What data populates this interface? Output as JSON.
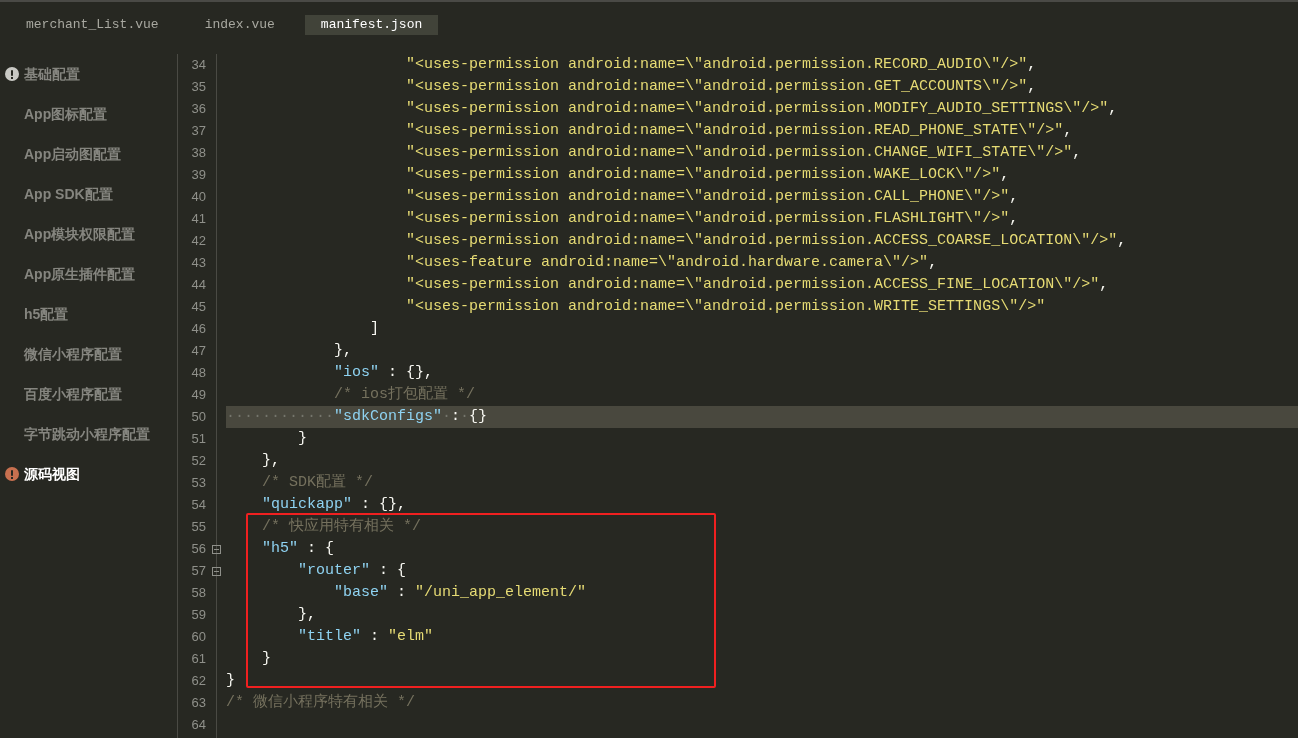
{
  "tabs": [
    {
      "label": "merchant_List.vue",
      "selected": false
    },
    {
      "label": "index.vue",
      "selected": false
    },
    {
      "label": "manifest.json",
      "selected": true
    }
  ],
  "sidebar": {
    "items": [
      {
        "label": "基础配置",
        "warning": true,
        "selected": false
      },
      {
        "label": "App图标配置",
        "warning": false,
        "selected": false
      },
      {
        "label": "App启动图配置",
        "warning": false,
        "selected": false
      },
      {
        "label": "App SDK配置",
        "warning": false,
        "selected": false
      },
      {
        "label": "App模块权限配置",
        "warning": false,
        "selected": false
      },
      {
        "label": "App原生插件配置",
        "warning": false,
        "selected": false
      },
      {
        "label": "h5配置",
        "warning": false,
        "selected": false
      },
      {
        "label": "微信小程序配置",
        "warning": false,
        "selected": false
      },
      {
        "label": "百度小程序配置",
        "warning": false,
        "selected": false
      },
      {
        "label": "字节跳动小程序配置",
        "warning": false,
        "selected": false
      },
      {
        "label": "源码视图",
        "warning": true,
        "selected": true
      }
    ]
  },
  "editor": {
    "lines": [
      {
        "number": "34",
        "foldable": false,
        "highlighted": false,
        "boxed": false,
        "tokens": [
          {
            "kind": "string",
            "text": "                    \"<uses-permission android:name=\\\"android.permission.RECORD_AUDIO\\\"/>\""
          },
          {
            "kind": "punct",
            "text": ","
          }
        ]
      },
      {
        "number": "35",
        "foldable": false,
        "highlighted": false,
        "boxed": false,
        "tokens": [
          {
            "kind": "string",
            "text": "                    \"<uses-permission android:name=\\\"android.permission.GET_ACCOUNTS\\\"/>\""
          },
          {
            "kind": "punct",
            "text": ","
          }
        ]
      },
      {
        "number": "36",
        "foldable": false,
        "highlighted": false,
        "boxed": false,
        "tokens": [
          {
            "kind": "string",
            "text": "                    \"<uses-permission android:name=\\\"android.permission.MODIFY_AUDIO_SETTINGS\\\"/>\""
          },
          {
            "kind": "punct",
            "text": ","
          }
        ]
      },
      {
        "number": "37",
        "foldable": false,
        "highlighted": false,
        "boxed": false,
        "tokens": [
          {
            "kind": "string",
            "text": "                    \"<uses-permission android:name=\\\"android.permission.READ_PHONE_STATE\\\"/>\""
          },
          {
            "kind": "punct",
            "text": ","
          }
        ]
      },
      {
        "number": "38",
        "foldable": false,
        "highlighted": false,
        "boxed": false,
        "tokens": [
          {
            "kind": "string",
            "text": "                    \"<uses-permission android:name=\\\"android.permission.CHANGE_WIFI_STATE\\\"/>\""
          },
          {
            "kind": "punct",
            "text": ","
          }
        ]
      },
      {
        "number": "39",
        "foldable": false,
        "highlighted": false,
        "boxed": false,
        "tokens": [
          {
            "kind": "string",
            "text": "                    \"<uses-permission android:name=\\\"android.permission.WAKE_LOCK\\\"/>\""
          },
          {
            "kind": "punct",
            "text": ","
          }
        ]
      },
      {
        "number": "40",
        "foldable": false,
        "highlighted": false,
        "boxed": false,
        "tokens": [
          {
            "kind": "string",
            "text": "                    \"<uses-permission android:name=\\\"android.permission.CALL_PHONE\\\"/>\""
          },
          {
            "kind": "punct",
            "text": ","
          }
        ]
      },
      {
        "number": "41",
        "foldable": false,
        "highlighted": false,
        "boxed": false,
        "tokens": [
          {
            "kind": "string",
            "text": "                    \"<uses-permission android:name=\\\"android.permission.FLASHLIGHT\\\"/>\""
          },
          {
            "kind": "punct",
            "text": ","
          }
        ]
      },
      {
        "number": "42",
        "foldable": false,
        "highlighted": false,
        "boxed": false,
        "tokens": [
          {
            "kind": "string",
            "text": "                    \"<uses-permission android:name=\\\"android.permission.ACCESS_COARSE_LOCATION\\\"/>\""
          },
          {
            "kind": "punct",
            "text": ","
          }
        ]
      },
      {
        "number": "43",
        "foldable": false,
        "highlighted": false,
        "boxed": false,
        "tokens": [
          {
            "kind": "string",
            "text": "                    \"<uses-feature android:name=\\\"android.hardware.camera\\\"/>\""
          },
          {
            "kind": "punct",
            "text": ","
          }
        ]
      },
      {
        "number": "44",
        "foldable": false,
        "highlighted": false,
        "boxed": false,
        "tokens": [
          {
            "kind": "string",
            "text": "                    \"<uses-permission android:name=\\\"android.permission.ACCESS_FINE_LOCATION\\\"/>\""
          },
          {
            "kind": "punct",
            "text": ","
          }
        ]
      },
      {
        "number": "45",
        "foldable": false,
        "highlighted": false,
        "boxed": false,
        "tokens": [
          {
            "kind": "string",
            "text": "                    \"<uses-permission android:name=\\\"android.permission.WRITE_SETTINGS\\\"/>\""
          }
        ]
      },
      {
        "number": "46",
        "foldable": false,
        "highlighted": false,
        "boxed": false,
        "tokens": [
          {
            "kind": "punct",
            "text": "                ]"
          }
        ]
      },
      {
        "number": "47",
        "foldable": false,
        "highlighted": false,
        "boxed": false,
        "tokens": [
          {
            "kind": "punct",
            "text": "            },"
          }
        ]
      },
      {
        "number": "48",
        "foldable": false,
        "highlighted": false,
        "boxed": false,
        "tokens": [
          {
            "kind": "key",
            "text": "            \"ios\""
          },
          {
            "kind": "punct",
            "text": " : {},"
          }
        ]
      },
      {
        "number": "49",
        "foldable": false,
        "highlighted": false,
        "boxed": false,
        "tokens": [
          {
            "kind": "comment",
            "text": "            /* ios打包配置 */"
          }
        ]
      },
      {
        "number": "50",
        "foldable": false,
        "highlighted": true,
        "boxed": false,
        "tokens": [
          {
            "kind": "whitespace",
            "text": "············"
          },
          {
            "kind": "key",
            "text": "\"sdkConfigs\""
          },
          {
            "kind": "whitespace",
            "text": "·"
          },
          {
            "kind": "punct",
            "text": ":"
          },
          {
            "kind": "whitespace",
            "text": "·"
          },
          {
            "kind": "punct",
            "text": "{}"
          }
        ]
      },
      {
        "number": "51",
        "foldable": false,
        "highlighted": false,
        "boxed": false,
        "tokens": [
          {
            "kind": "punct",
            "text": "        }"
          }
        ]
      },
      {
        "number": "52",
        "foldable": false,
        "highlighted": false,
        "boxed": false,
        "tokens": [
          {
            "kind": "punct",
            "text": "    },"
          }
        ]
      },
      {
        "number": "53",
        "foldable": false,
        "highlighted": false,
        "boxed": false,
        "tokens": [
          {
            "kind": "comment",
            "text": "    /* SDK配置 */"
          }
        ]
      },
      {
        "number": "54",
        "foldable": false,
        "highlighted": false,
        "boxed": false,
        "tokens": [
          {
            "kind": "key",
            "text": "    \"quickapp\""
          },
          {
            "kind": "punct",
            "text": " : {},"
          }
        ]
      },
      {
        "number": "55",
        "foldable": false,
        "highlighted": false,
        "boxed": true,
        "tokens": [
          {
            "kind": "comment",
            "text": "    /* 快应用特有相关 */"
          }
        ]
      },
      {
        "number": "56",
        "foldable": true,
        "highlighted": false,
        "boxed": true,
        "tokens": [
          {
            "kind": "key",
            "text": "    \"h5\""
          },
          {
            "kind": "punct",
            "text": " : {"
          }
        ]
      },
      {
        "number": "57",
        "foldable": true,
        "highlighted": false,
        "boxed": true,
        "tokens": [
          {
            "kind": "key",
            "text": "        \"router\""
          },
          {
            "kind": "punct",
            "text": " : {"
          }
        ]
      },
      {
        "number": "58",
        "foldable": false,
        "highlighted": false,
        "boxed": true,
        "tokens": [
          {
            "kind": "key",
            "text": "            \"base\""
          },
          {
            "kind": "punct",
            "text": " : "
          },
          {
            "kind": "string",
            "text": "\"/uni_app_element/\""
          }
        ]
      },
      {
        "number": "59",
        "foldable": false,
        "highlighted": false,
        "boxed": true,
        "tokens": [
          {
            "kind": "punct",
            "text": "        },"
          }
        ]
      },
      {
        "number": "60",
        "foldable": false,
        "highlighted": false,
        "boxed": true,
        "tokens": [
          {
            "kind": "key",
            "text": "        \"title\""
          },
          {
            "kind": "punct",
            "text": " : "
          },
          {
            "kind": "string",
            "text": "\"elm\""
          }
        ]
      },
      {
        "number": "61",
        "foldable": false,
        "highlighted": false,
        "boxed": true,
        "tokens": [
          {
            "kind": "punct",
            "text": "    }"
          }
        ]
      },
      {
        "number": "62",
        "foldable": false,
        "highlighted": false,
        "boxed": false,
        "tokens": [
          {
            "kind": "punct",
            "text": "}"
          }
        ]
      },
      {
        "number": "63",
        "foldable": false,
        "highlighted": false,
        "boxed": false,
        "tokens": [
          {
            "kind": "comment",
            "text": "/* 微信小程序特有相关 */"
          }
        ]
      },
      {
        "number": "64",
        "foldable": false,
        "highlighted": false,
        "boxed": false
      }
    ]
  }
}
